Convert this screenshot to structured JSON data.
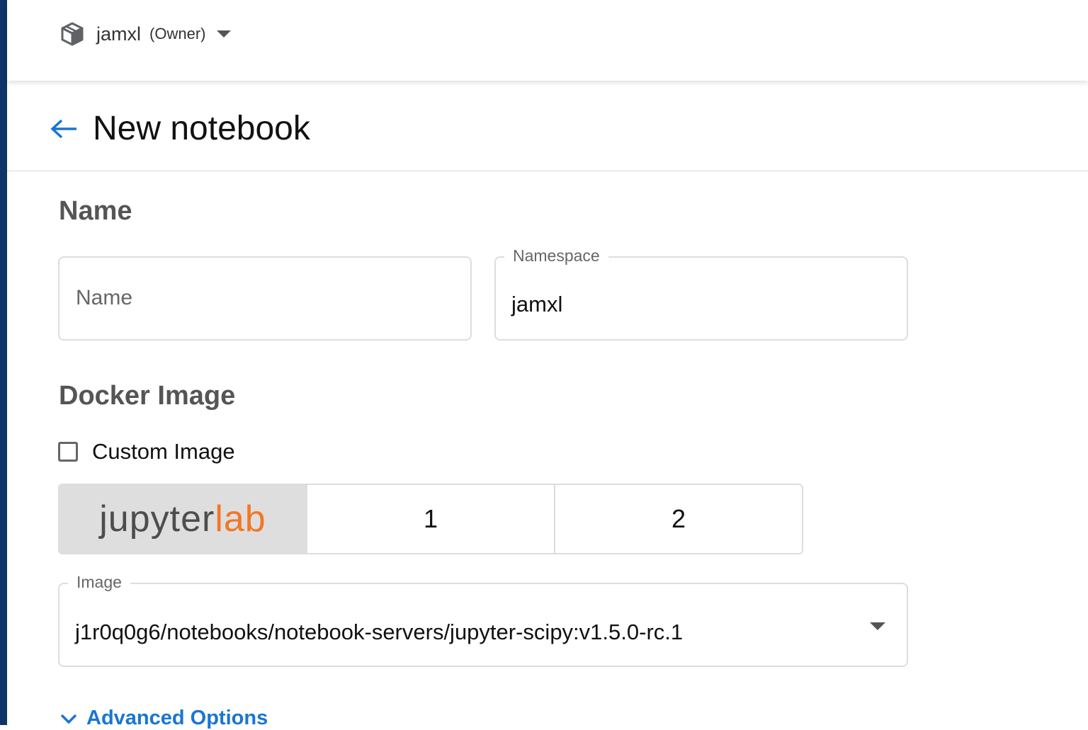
{
  "topbar": {
    "namespace": "jamxl",
    "role": "(Owner)"
  },
  "header": {
    "title": "New notebook"
  },
  "name_section": {
    "heading": "Name",
    "name_placeholder": "Name",
    "namespace_label": "Namespace",
    "namespace_value": "jamxl"
  },
  "image_section": {
    "heading": "Docker Image",
    "custom_image_label": "Custom Image",
    "custom_image_checked": false,
    "server_types": [
      {
        "logo_part1": "jupyter",
        "logo_part2": "lab",
        "selected": true
      },
      {
        "label": "1",
        "selected": false
      },
      {
        "label": "2",
        "selected": false
      }
    ],
    "image_label": "Image",
    "image_value": "j1r0q0g6/notebooks/notebook-servers/jupyter-scipy:v1.5.0-rc.1"
  },
  "advanced": {
    "label": "Advanced Options"
  },
  "colors": {
    "accent": "#1976d2",
    "side_strip": "#0e3568",
    "jupyter_orange": "#f37626"
  },
  "icons": {
    "namespace": "cube-icon",
    "back": "arrow-left-icon",
    "namespace_dropdown": "caret-down-icon",
    "image_dropdown": "caret-down-icon",
    "advanced": "chevron-down-icon"
  }
}
